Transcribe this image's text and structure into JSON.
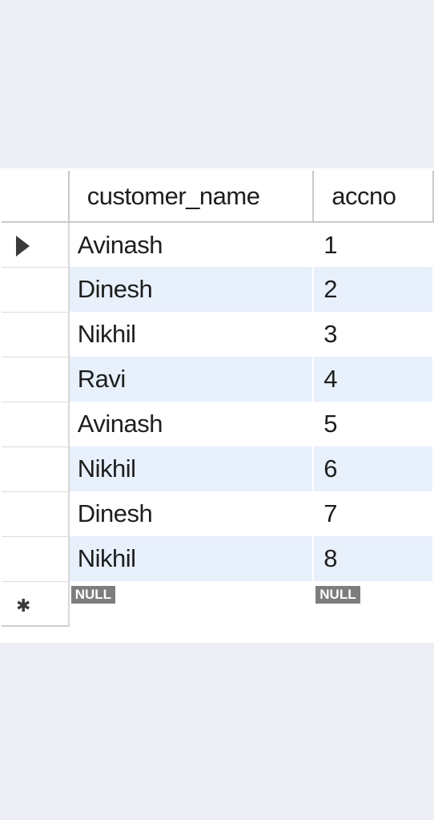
{
  "columns": {
    "name_header": "customer_name",
    "accno_header": "accno"
  },
  "rows": [
    {
      "customer_name": "Avinash",
      "accno": "1"
    },
    {
      "customer_name": "Dinesh",
      "accno": "2"
    },
    {
      "customer_name": "Nikhil",
      "accno": "3"
    },
    {
      "customer_name": "Ravi",
      "accno": "4"
    },
    {
      "customer_name": "Avinash",
      "accno": "5"
    },
    {
      "customer_name": "Nikhil",
      "accno": "6"
    },
    {
      "customer_name": "Dinesh",
      "accno": "7"
    },
    {
      "customer_name": "Nikhil",
      "accno": "8"
    }
  ],
  "new_row": {
    "customer_name": "NULL",
    "accno": "NULL"
  },
  "icons": {
    "current_row": "row-pointer-arrow-icon",
    "new_row": "new-row-asterisk-icon"
  },
  "colors": {
    "alt_row": "#e8f0fc",
    "null_badge": "#7d7d7d",
    "background": "#eeeff4"
  }
}
